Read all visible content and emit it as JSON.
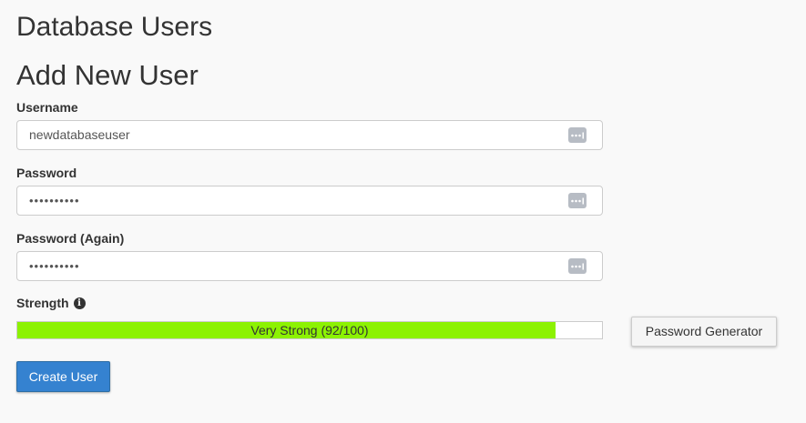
{
  "page_title": "Database Users",
  "section_title": "Add New User",
  "form": {
    "username": {
      "label": "Username",
      "value": "newdatabaseuser"
    },
    "password": {
      "label": "Password",
      "value": "••••••••••"
    },
    "password_again": {
      "label": "Password (Again)",
      "value": "••••••••••"
    },
    "strength": {
      "label": "Strength",
      "meter_text": "Very Strong (92/100)",
      "score": 92,
      "max": 100,
      "fill_color": "#8cf202"
    },
    "password_generator_label": "Password Generator",
    "create_user_label": "Create User"
  },
  "icons": {
    "field_icon": "password-manager-icon",
    "strength_info": "info-icon"
  },
  "colors": {
    "primary_button": "#3582d0",
    "meter_fill": "#8cf202"
  }
}
